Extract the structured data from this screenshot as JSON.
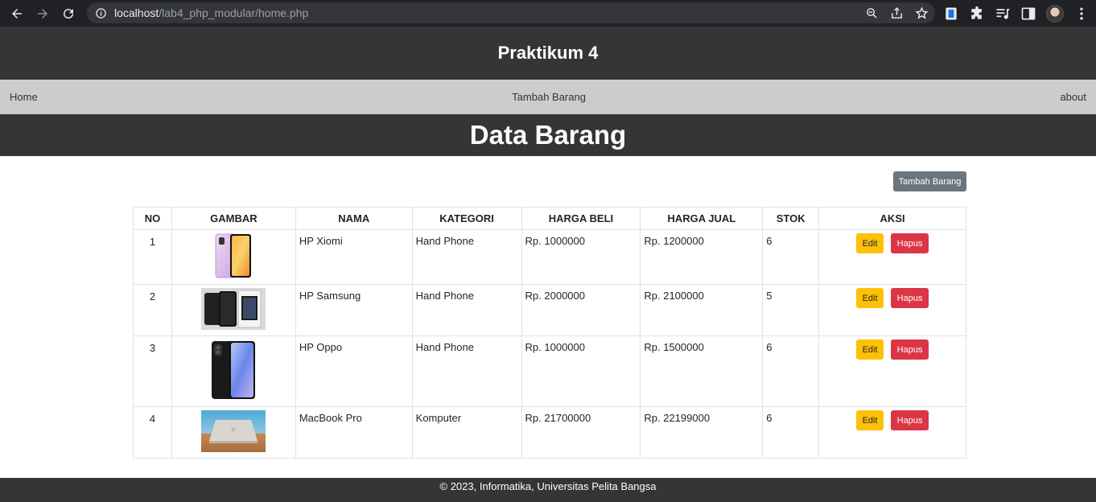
{
  "browser": {
    "url_host": "localhost",
    "url_path": "/lab4_php_modular/home.php"
  },
  "header": {
    "title": "Praktikum 4"
  },
  "nav": {
    "home": "Home",
    "add": "Tambah Barang",
    "about": "about"
  },
  "page": {
    "title": "Data Barang",
    "add_button": "Tambah Barang"
  },
  "table": {
    "headers": {
      "no": "NO",
      "gambar": "GAMBAR",
      "nama": "NAMA",
      "kategori": "KATEGORI",
      "harga_beli": "HARGA BELI",
      "harga_jual": "HARGA JUAL",
      "stok": "STOK",
      "aksi": "AKSI"
    },
    "rows": [
      {
        "no": "1",
        "nama": "HP Xiomi",
        "kategori": "Hand Phone",
        "harga_beli": "Rp. 1000000",
        "harga_jual": "Rp. 1200000",
        "stok": "6",
        "image": "phone-purple-icon"
      },
      {
        "no": "2",
        "nama": "HP Samsung",
        "kategori": "Hand Phone",
        "harga_beli": "Rp. 2000000",
        "harga_jual": "Rp. 2100000",
        "stok": "5",
        "image": "phone-box-icon"
      },
      {
        "no": "3",
        "nama": "HP Oppo",
        "kategori": "Hand Phone",
        "harga_beli": "Rp. 1000000",
        "harga_jual": "Rp. 1500000",
        "stok": "6",
        "image": "phone-black-icon"
      },
      {
        "no": "4",
        "nama": "MacBook Pro",
        "kategori": "Komputer",
        "harga_beli": "Rp. 21700000",
        "harga_jual": "Rp. 22199000",
        "stok": "6",
        "image": "laptop-icon"
      }
    ],
    "edit_label": "Edit",
    "delete_label": "Hapus"
  },
  "footer": {
    "text": "© 2023, Informatika, Universitas Pelita Bangsa"
  },
  "colors": {
    "dark": "#353535",
    "nav": "#cccccc",
    "edit": "#ffc107",
    "delete": "#dc3545",
    "secondary": "#6c757d"
  }
}
